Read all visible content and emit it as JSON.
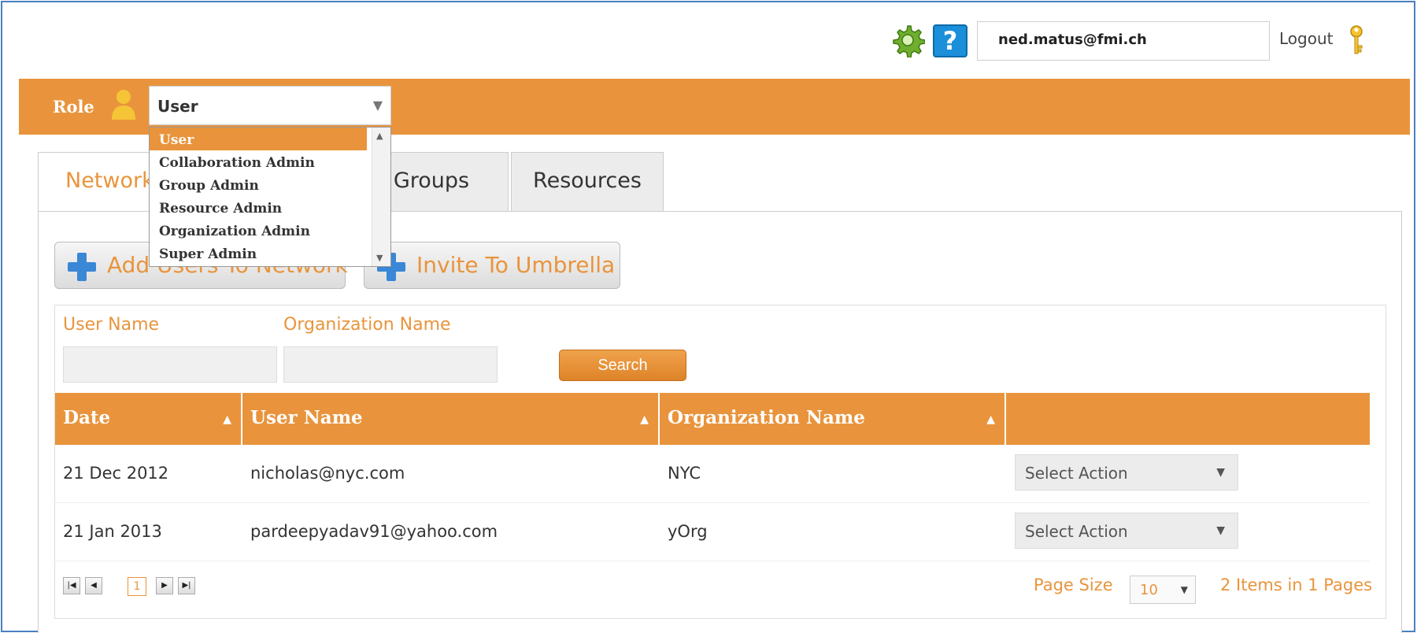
{
  "header": {
    "help_glyph": "?",
    "email": "ned.matus@fmi.ch",
    "logout_label": "Logout",
    "icons": [
      "gear-icon",
      "help-icon",
      "key-icon"
    ]
  },
  "role_bar": {
    "label": "Role",
    "selected": "User",
    "options": [
      "User",
      "Collaboration Admin",
      "Group Admin",
      "Resource Admin",
      "Organization Admin",
      "Super Admin"
    ]
  },
  "tabs": [
    {
      "label": "Network",
      "active": true
    },
    {
      "label": "Groups",
      "active": false
    },
    {
      "label": "Resources",
      "active": false
    }
  ],
  "actions": {
    "add_users": "Add Users To Network",
    "invite": "Invite To Umbrella"
  },
  "filters": {
    "user_name_label": "User Name",
    "org_name_label": "Organization Name",
    "search_label": "Search"
  },
  "table": {
    "columns": [
      "Date",
      "User Name",
      "Organization Name",
      ""
    ],
    "rows": [
      {
        "date": "21 Dec 2012",
        "user": "nicholas@nyc.com",
        "org": "NYC",
        "action": "Select Action"
      },
      {
        "date": "21 Jan 2013",
        "user": "pardeepyadav91@yahoo.com",
        "org": "yOrg",
        "action": "Select Action"
      }
    ]
  },
  "pager": {
    "current_page": "1",
    "page_size_label": "Page Size",
    "page_size": "10",
    "summary": "2 Items in 1 Pages"
  },
  "colors": {
    "accent": "#e9943c",
    "plus": "#3a87d6",
    "help": "#1b8fd9"
  }
}
